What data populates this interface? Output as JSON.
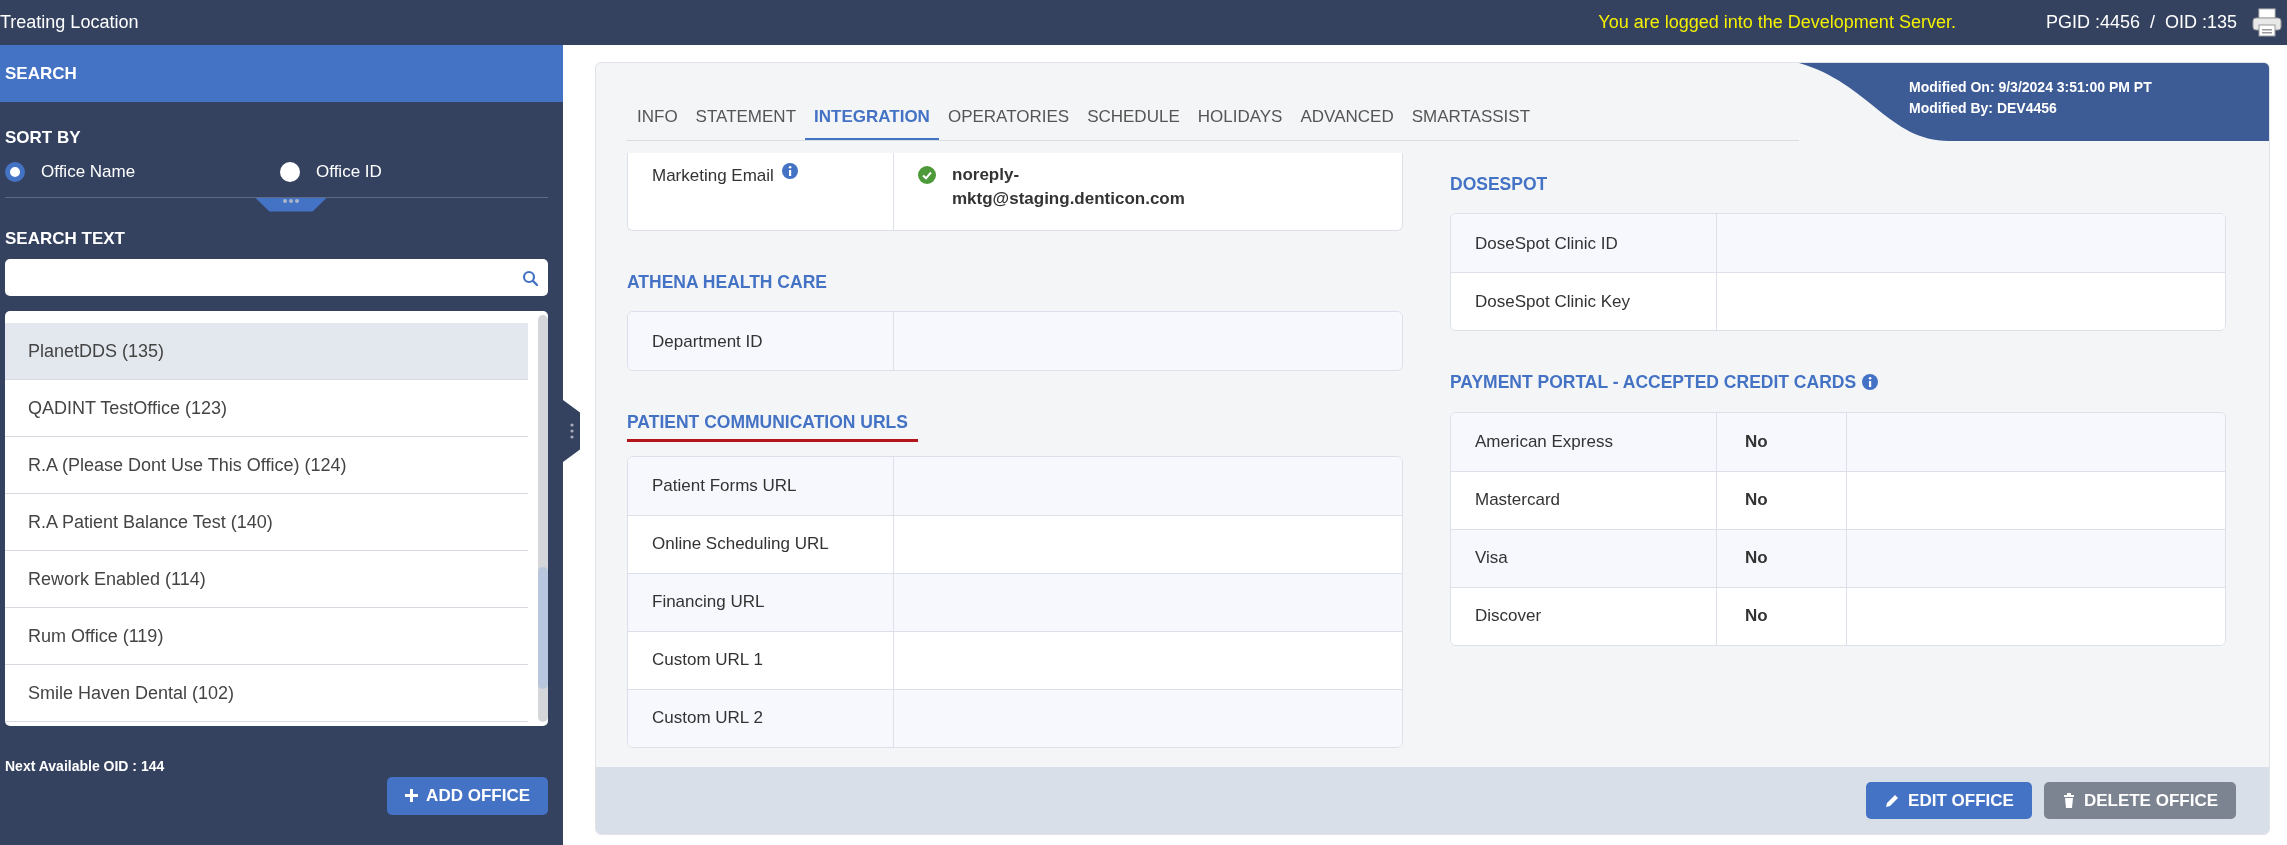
{
  "top_bar": {
    "title": "Treating Location",
    "server_notice": "You are logged into the Development Server.",
    "ids": "PGID :4456  /  OID :135"
  },
  "sidebar": {
    "header": "SEARCH",
    "sort_label": "SORT BY",
    "sort_options": [
      {
        "label": "Office Name",
        "selected": true
      },
      {
        "label": "Office ID",
        "selected": false
      }
    ],
    "search_label": "SEARCH TEXT",
    "offices": [
      {
        "label": "PlanetDDS (135)",
        "selected": true
      },
      {
        "label": "QADINT TestOffice (123)",
        "selected": false
      },
      {
        "label": "R.A (Please Dont Use This Office) (124)",
        "selected": false
      },
      {
        "label": "R.A Patient Balance Test (140)",
        "selected": false
      },
      {
        "label": "Rework Enabled (114)",
        "selected": false
      },
      {
        "label": "Rum Office (119)",
        "selected": false
      },
      {
        "label": "Smile Haven Dental (102)",
        "selected": false
      }
    ],
    "next_oid": "Next Available OID : 144",
    "add_button": "ADD OFFICE"
  },
  "tabs": [
    {
      "label": "INFO",
      "selected": false
    },
    {
      "label": "STATEMENT",
      "selected": false
    },
    {
      "label": "INTEGRATION",
      "selected": true
    },
    {
      "label": "OPERATORIES",
      "selected": false
    },
    {
      "label": "SCHEDULE",
      "selected": false
    },
    {
      "label": "HOLIDAYS",
      "selected": false
    },
    {
      "label": "ADVANCED",
      "selected": false
    },
    {
      "label": "SMARTASSIST",
      "selected": false
    }
  ],
  "modified": {
    "on": "Modified On: 9/3/2024 3:51:00 PM PT",
    "by": "Modified By: DEV4456"
  },
  "left_sections": [
    {
      "kind": "pairs",
      "rows": [
        {
          "label": "Marketing Email",
          "info": true,
          "value": "noreply-mktg@staging.denticon.com",
          "verified": true
        }
      ]
    },
    {
      "kind": "pairs",
      "heading": "ATHENA HEALTH CARE",
      "underlined": false,
      "info": false,
      "rows": [
        {
          "label": "Department ID",
          "info": false,
          "verified": false
        }
      ]
    },
    {
      "kind": "pairs",
      "heading": "PATIENT COMMUNICATION URLS",
      "underlined": true,
      "info": false,
      "rows": [
        {
          "label": "Patient Forms URL",
          "info": false,
          "verified": false
        },
        {
          "label": "Online Scheduling URL",
          "info": false,
          "verified": false
        },
        {
          "label": "Financing URL",
          "info": false,
          "verified": false
        },
        {
          "label": "Custom URL 1",
          "info": false,
          "verified": false
        },
        {
          "label": "Custom URL 2",
          "info": false,
          "verified": false
        }
      ]
    }
  ],
  "right_sections": [
    {
      "kind": "pairs",
      "heading": "DOSESPOT",
      "underlined": false,
      "info": false,
      "rows": [
        {
          "label": "DoseSpot Clinic ID",
          "info": false,
          "verified": false
        },
        {
          "label": "DoseSpot Clinic Key",
          "info": false,
          "verified": false
        }
      ]
    },
    {
      "kind": "triples",
      "heading": "PAYMENT PORTAL - ACCEPTED CREDIT CARDS",
      "underlined": false,
      "info": true,
      "rows": [
        {
          "label": "American Express",
          "info": false,
          "value": "No",
          "verified": false
        },
        {
          "label": "Mastercard",
          "info": false,
          "value": "No",
          "verified": false
        },
        {
          "label": "Visa",
          "info": false,
          "value": "No",
          "verified": false
        },
        {
          "label": "Discover",
          "info": false,
          "value": "No",
          "verified": false
        }
      ]
    }
  ],
  "footer": {
    "edit_button": "EDIT OFFICE",
    "delete_button": "DELETE OFFICE"
  }
}
